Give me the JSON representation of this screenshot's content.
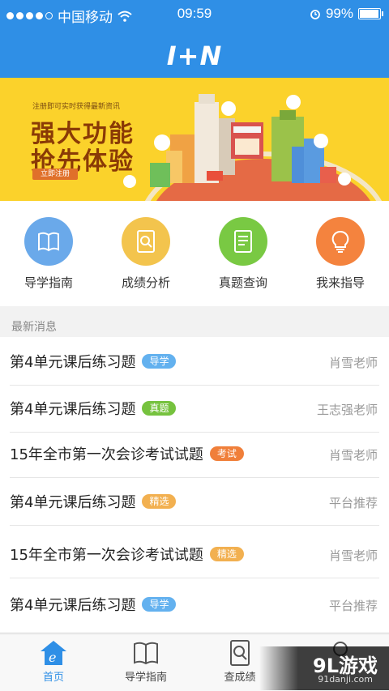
{
  "status_bar": {
    "carrier": "中国移动",
    "time": "09:59",
    "battery": "99%",
    "battery_level": 0.99
  },
  "header": {
    "logo": "I+N"
  },
  "banner": {
    "small_text": "注册即可实时获得最新资讯",
    "headline_1": "强大功能",
    "headline_2": "抢先体验",
    "register_button": "立即注册",
    "bg_color": "#fbd22b"
  },
  "quick_actions": [
    {
      "label": "导学指南",
      "icon": "book-icon",
      "color": "#6aa9ea"
    },
    {
      "label": "成绩分析",
      "icon": "search-document-icon",
      "color": "#f3c44d"
    },
    {
      "label": "真题查询",
      "icon": "list-document-icon",
      "color": "#79c943"
    },
    {
      "label": "我来指导",
      "icon": "lightbulb-icon",
      "color": "#f4833e"
    }
  ],
  "news": {
    "section_title": "最新消息",
    "items": [
      {
        "title": "第4单元课后练习题",
        "tag": "导学",
        "tag_color": "#63b1ef",
        "author": "肖雪老师"
      },
      {
        "title": "第4单元课后练习题",
        "tag": "真题",
        "tag_color": "#76c23e",
        "author": "王志强老师"
      },
      {
        "title": "15年全市第一次会诊考试试题",
        "tag": "考试",
        "tag_color": "#f07f3a",
        "author": "肖雪老师"
      },
      {
        "title": "第4单元课后练习题",
        "tag": "精选",
        "tag_color": "#f2b050",
        "author": "平台推荐"
      },
      {
        "title": "15年全市第一次会诊考试试题",
        "tag": "精选",
        "tag_color": "#f2b050",
        "author": "肖雪老师"
      },
      {
        "title": "第4单元课后练习题",
        "tag": "导学",
        "tag_color": "#63b1ef",
        "author": "平台推荐"
      }
    ]
  },
  "tab_bar": {
    "tabs": [
      {
        "label": "首页",
        "icon": "home-icon",
        "active": true
      },
      {
        "label": "导学指南",
        "icon": "book-icon",
        "active": false
      },
      {
        "label": "查成绩",
        "icon": "search-document-icon",
        "active": false
      },
      {
        "label": "",
        "icon": "profile-icon",
        "active": false
      }
    ]
  },
  "watermark": {
    "brand": "9L游戏",
    "url": "91danji.com"
  },
  "colors": {
    "primary": "#2f8fe6",
    "banner": "#fbd22b"
  }
}
